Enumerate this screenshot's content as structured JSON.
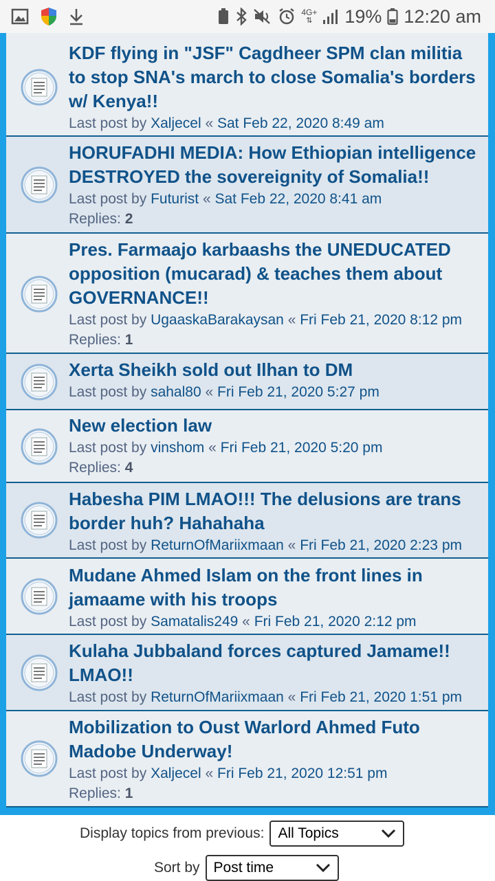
{
  "status_bar": {
    "battery": "19%",
    "time": "12:20 am",
    "network": "4G+"
  },
  "topics": [
    {
      "title": "KDF flying in \"JSF\" Cagdheer SPM clan militia to stop SNA's march to close Somalia's borders w/ Kenya!!",
      "last_post_label": "Last post by",
      "author": "Xaljecel",
      "date": "Sat Feb 22, 2020 8:49 am",
      "replies": null
    },
    {
      "title": "HORUFADHI MEDIA: How Ethiopian intelligence DESTROYED the sovereignity of Somalia!!",
      "last_post_label": "Last post by",
      "author": "Futurist",
      "date": "Sat Feb 22, 2020 8:41 am",
      "replies": "2"
    },
    {
      "title": "Pres. Farmaajo karbaashs the UNEDUCATED opposition (mucarad) & teaches them about GOVERNANCE!!",
      "last_post_label": "Last post by",
      "author": "UgaaskaBarakaysan",
      "date": "Fri Feb 21, 2020 8:12 pm",
      "replies": "1"
    },
    {
      "title": "Xerta Sheikh sold out Ilhan to DM",
      "last_post_label": "Last post by",
      "author": "sahal80",
      "date": "Fri Feb 21, 2020 5:27 pm",
      "replies": null
    },
    {
      "title": "New election law",
      "last_post_label": "Last post by",
      "author": "vinshom",
      "date": "Fri Feb 21, 2020 5:20 pm",
      "replies": "4"
    },
    {
      "title": "Habesha PIM LMAO!!! The delusions are trans border huh? Hahahaha",
      "last_post_label": "Last post by",
      "author": "ReturnOfMariixmaan",
      "date": "Fri Feb 21, 2020 2:23 pm",
      "replies": null
    },
    {
      "title": "Mudane Ahmed Islam on the front lines in jamaame with his troops",
      "last_post_label": "Last post by",
      "author": "Samatalis249",
      "date": "Fri Feb 21, 2020 2:12 pm",
      "replies": null
    },
    {
      "title": "Kulaha Jubbaland forces captured Jamame!! LMAO!!",
      "last_post_label": "Last post by",
      "author": "ReturnOfMariixmaan",
      "date": "Fri Feb 21, 2020 1:51 pm",
      "replies": null
    },
    {
      "title": "Mobilization to Oust Warlord Ahmed Futo Madobe Underway!",
      "last_post_label": "Last post by",
      "author": "Xaljecel",
      "date": "Fri Feb 21, 2020 12:51 pm",
      "replies": "1"
    }
  ],
  "replies_label": "Replies:",
  "separator": "«",
  "display_filter": {
    "label": "Display topics from previous:",
    "value": "All Topics"
  },
  "sort": {
    "label": "Sort by",
    "value": "Post time"
  }
}
